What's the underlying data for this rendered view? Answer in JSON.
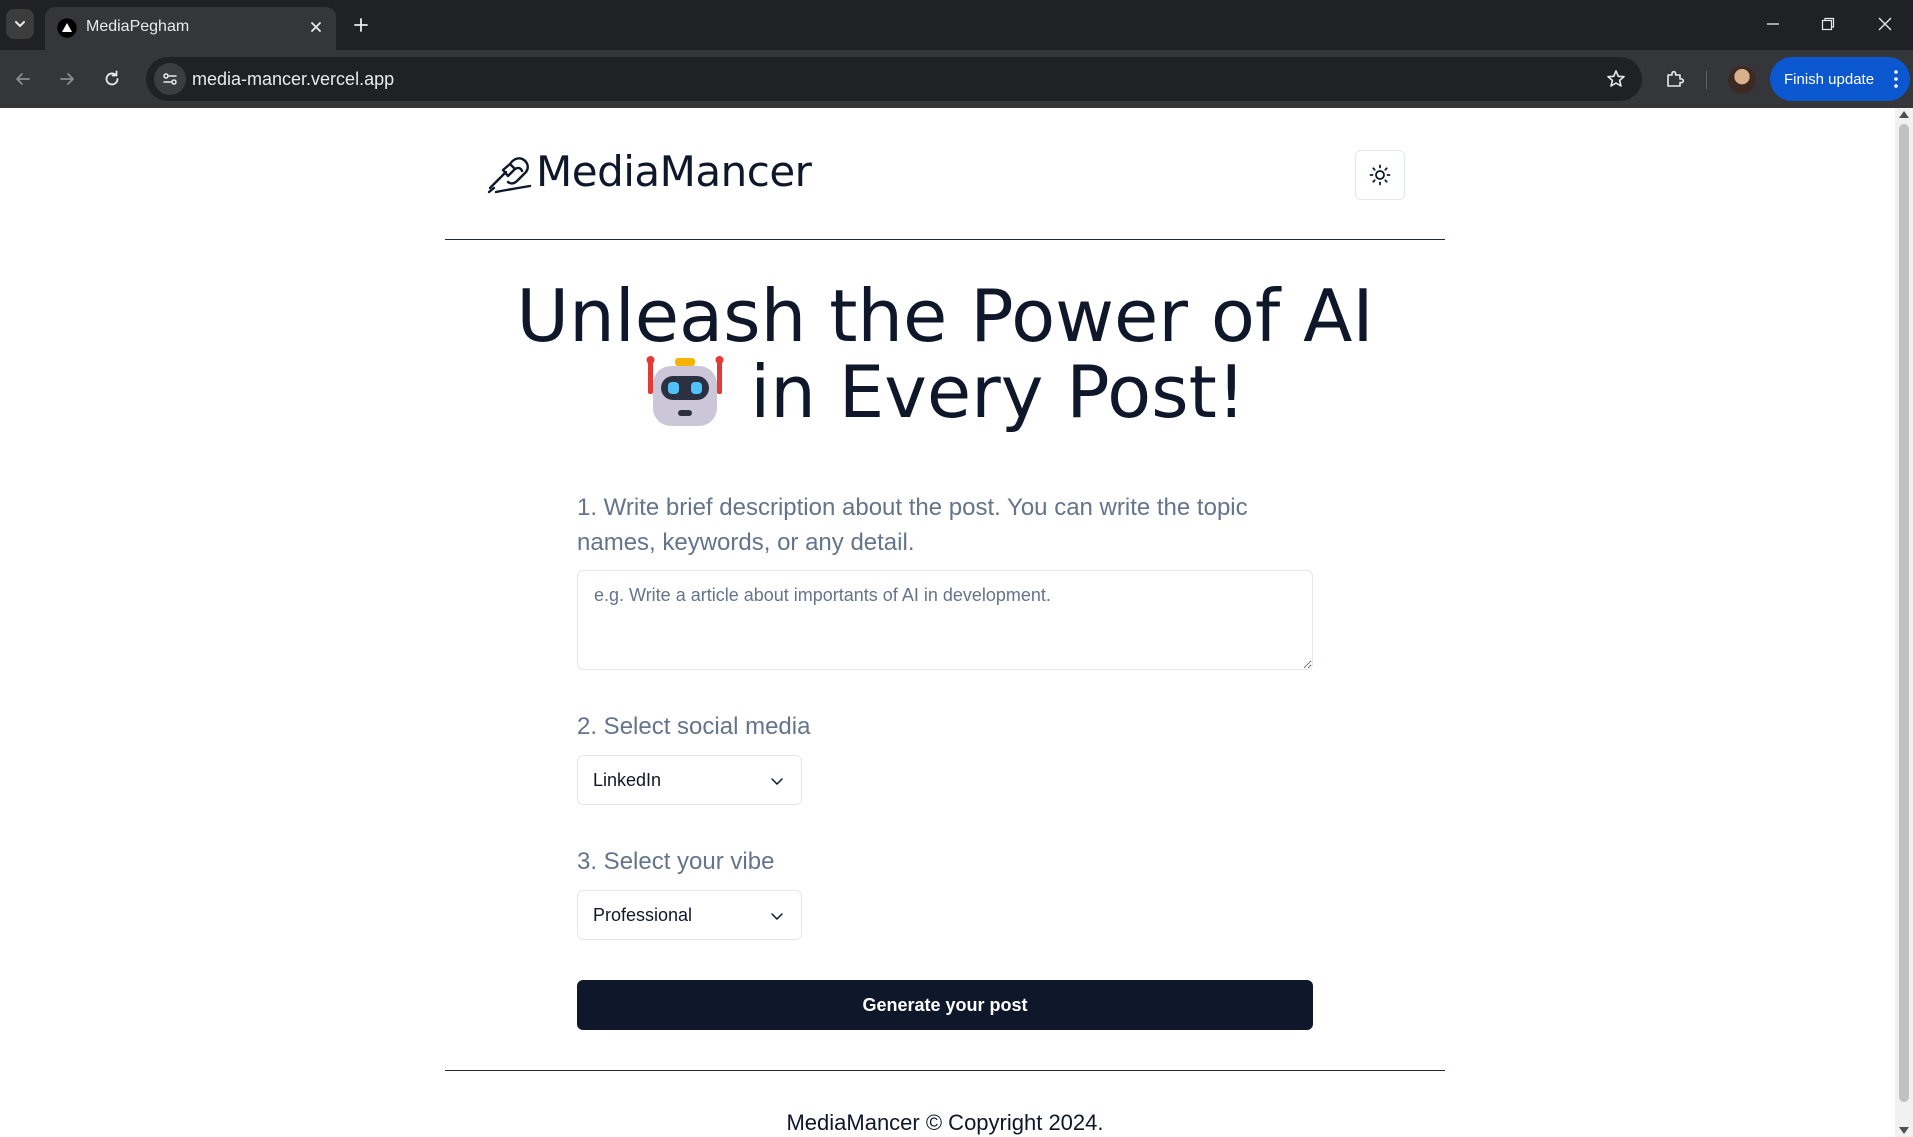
{
  "browser": {
    "tab_title": "MediaPegham",
    "url": "media-mancer.vercel.app",
    "finish_update_label": "Finish update"
  },
  "header": {
    "brand_name": "MediaMancer",
    "theme_icon": "sun-icon",
    "brand_icon": "writing-hand-icon"
  },
  "hero": {
    "line1": "Unleash the Power of AI",
    "line2": "in Every Post!",
    "emoji_icon": "robot-icon"
  },
  "form": {
    "description_label": "1. Write brief description about the post. You can write the topic names, keywords, or any detail.",
    "description_placeholder": "e.g. Write a article about importants of AI in development.",
    "description_value": "",
    "social_label": "2. Select social media",
    "social_selected": "LinkedIn",
    "vibe_label": "3. Select your vibe",
    "vibe_selected": "Professional",
    "generate_label": "Generate your post"
  },
  "footer": {
    "text": "MediaMancer © Copyright 2024."
  },
  "colors": {
    "primary": "#0f172a",
    "muted_text": "#64748b",
    "border": "#e2e8f0",
    "chrome_dark": "#202124",
    "chrome_toolbar": "#35363a",
    "update_blue": "#0b57d0"
  }
}
